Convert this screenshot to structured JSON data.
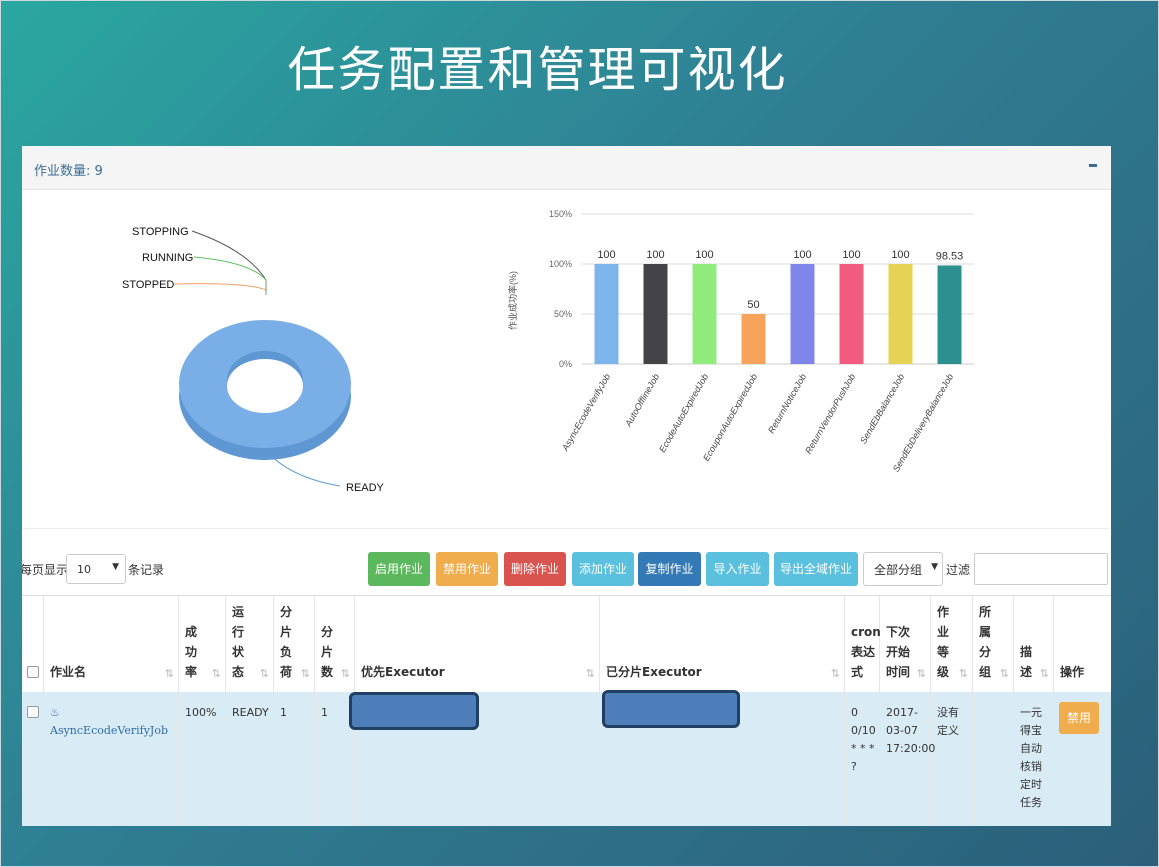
{
  "slide": {
    "title": "任务配置和管理可视化"
  },
  "panel": {
    "job_count_label": "作业数量: 9"
  },
  "pie": {
    "labels": [
      "STOPPING",
      "RUNNING",
      "STOPPED",
      "READY"
    ],
    "colors": {
      "ring": "#7aaee6",
      "stopping": "#555555",
      "running": "#5fbf5f",
      "stopped": "#f0a060",
      "ready": "#5a9fd4"
    }
  },
  "chart_data": {
    "type": "bar",
    "ylabel": "作业成功率(%)",
    "y_ticks": [
      "150%",
      "100%",
      "50%",
      "0%"
    ],
    "ylim": [
      0,
      150
    ],
    "categories": [
      "AsyncEcodeVerifyJob",
      "AutoOfflineJob",
      "EcodeAutoExpiredJob",
      "EcouponAutoExpiredJob",
      "ReturnNoticeJob",
      "ReturnVendorPushJob",
      "SendEbBalanceJob",
      "SendEbDeliveryBalanceJob"
    ],
    "values": [
      100,
      100,
      100,
      50,
      100,
      100,
      100,
      98.53
    ],
    "value_labels": [
      "100",
      "100",
      "100",
      "50",
      "100",
      "100",
      "100",
      "98.53"
    ],
    "bar_colors": [
      "#7cb5ec",
      "#434348",
      "#90ed7d",
      "#f7a35c",
      "#8085e9",
      "#f15c80",
      "#e4d354",
      "#2b908f"
    ]
  },
  "toolbar": {
    "per_page_label": "每页显示",
    "per_page_value": "10",
    "per_page_suffix": "条记录",
    "buttons": [
      {
        "label": "启用作业",
        "color": "#5cb85c"
      },
      {
        "label": "禁用作业",
        "color": "#f0ad4e"
      },
      {
        "label": "删除作业",
        "color": "#d9534f"
      },
      {
        "label": "添加作业",
        "color": "#5bc0de"
      },
      {
        "label": "复制作业",
        "color": "#337ab7"
      },
      {
        "label": "导入作业",
        "color": "#5bc0de"
      },
      {
        "label": "导出全域作业",
        "color": "#5bc0de"
      }
    ],
    "group_value": "全部分组",
    "filter_label": "过滤"
  },
  "table": {
    "headers": [
      "作业名",
      "成\n功\n率",
      "运\n行\n状\n态",
      "分\n片\n负\n荷",
      "分\n片\n数",
      "优先Executor",
      "已分片Executor",
      "cron\n表达\n式",
      "下次\n开始\n时间",
      "作\n业\n等\n级",
      "所\n属\n分\n组",
      "描\n述",
      "操作"
    ],
    "row": {
      "name": "AsyncEcodeVerifyJob",
      "success_rate": "100%",
      "status": "READY",
      "shard_load": "1",
      "shard_count": "1",
      "cron": "0\n0/10\n* * *\n?",
      "next_time": "2017-\n03-07\n17:20:00",
      "level": "没有\n定义",
      "group": "",
      "desc": "一元\n得宝\n自动\n核销\n定时\n任务",
      "action": "禁用"
    }
  }
}
